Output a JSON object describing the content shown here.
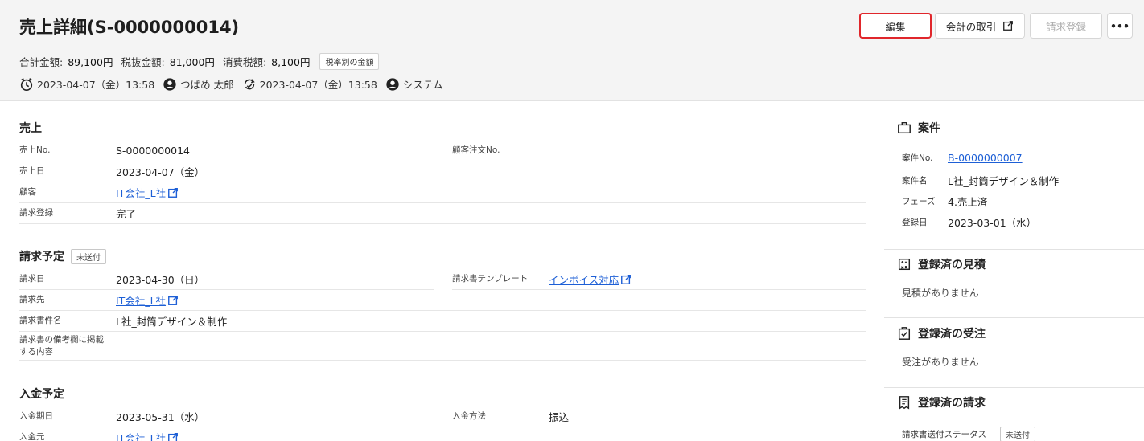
{
  "header": {
    "title": "売上詳細(S-0000000014)",
    "summary": {
      "total_label": "合計金額:",
      "total_value": "89,100円",
      "taxex_label": "税抜金額:",
      "taxex_value": "81,000円",
      "tax_label": "消費税額:",
      "tax_value": "8,100円",
      "rate_button": "税率別の金額"
    },
    "meta": {
      "created_at": "2023-04-07（金）13:58",
      "created_by": "つばめ 太郎",
      "updated_at": "2023-04-07（金）13:58",
      "updated_by": "システム"
    },
    "buttons": {
      "edit": "編集",
      "accounting": "会計の取引",
      "billing": "請求登録",
      "more": "•••"
    }
  },
  "sales": {
    "title": "売上",
    "no_label": "売上No.",
    "no_value": "S-0000000014",
    "order_no_label": "顧客注文No.",
    "order_no_value": "",
    "date_label": "売上日",
    "date_value": "2023-04-07（金）",
    "customer_label": "顧客",
    "customer_value": "IT会社_L社",
    "billing_label": "請求登録",
    "billing_value": "完了"
  },
  "billing": {
    "title": "請求予定",
    "status": "未送付",
    "date_label": "請求日",
    "date_value": "2023-04-30（日）",
    "template_label": "請求書テンプレート",
    "template_value": "インボイス対応",
    "to_label": "請求先",
    "to_value": "IT会社_L社",
    "subject_label": "請求書件名",
    "subject_value": "L社_封筒デザイン＆制作",
    "note_label": "請求書の備考欄に掲載する内容",
    "note_value": ""
  },
  "payment": {
    "title": "入金予定",
    "due_label": "入金期日",
    "due_value": "2023-05-31（水）",
    "method_label": "入金方法",
    "method_value": "振込",
    "from_label": "入金元",
    "from_value": "IT会社_L社"
  },
  "sidebar": {
    "project": {
      "title": "案件",
      "no_label": "案件No.",
      "no_value": "B-0000000007",
      "name_label": "案件名",
      "name_value": "L社_封筒デザイン＆制作",
      "phase_label": "フェーズ",
      "phase_value": "4.売上済",
      "date_label": "登録日",
      "date_value": "2023-03-01（水）"
    },
    "estimates": {
      "title": "登録済の見積",
      "empty": "見積がありません"
    },
    "orders": {
      "title": "登録済の受注",
      "empty": "受注がありません"
    },
    "invoices": {
      "title": "登録済の請求",
      "status_label": "請求書送付ステータス",
      "status_value": "未送付"
    }
  }
}
